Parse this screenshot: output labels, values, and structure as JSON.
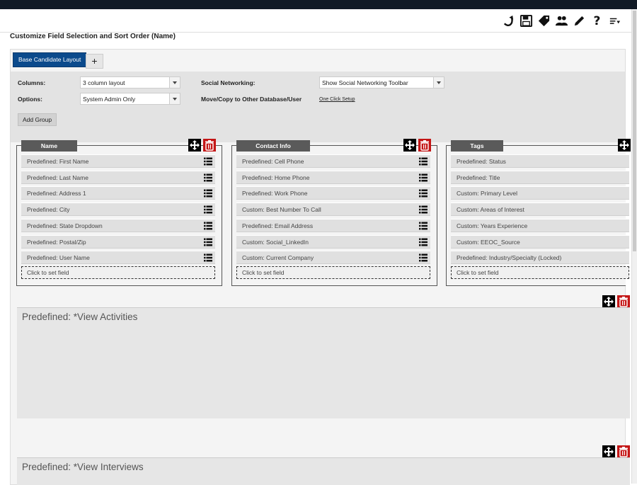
{
  "page_title": "Customize Field Selection and Sort Order (Name)",
  "toolbar": {
    "icons": [
      "return-icon",
      "save-icon",
      "tag-icon",
      "users-icon",
      "edit-icon",
      "help-icon",
      "sort-icon"
    ]
  },
  "tabs": {
    "active_label": "Base Candidate Layout",
    "add_label": "+"
  },
  "settings": {
    "columns_label": "Columns:",
    "columns_value": "3 column layout",
    "options_label": "Options:",
    "options_value": "System Admin Only",
    "social_label": "Social Networking:",
    "social_value": "Show Social Networking Toolbar",
    "move_label": "Move/Copy to Other Database/User",
    "one_click_link": "One Click Setup",
    "add_group_label": "Add Group"
  },
  "groups": [
    {
      "title": "Name",
      "fields": [
        "Predefined: First Name",
        "Predefined: Last Name",
        "Predefined: Address 1",
        "Predefined: City",
        "Predefined: State Dropdown",
        "Predefined: Postal/Zip",
        "Predefined: User Name"
      ],
      "set_field": "Click to set field"
    },
    {
      "title": "Contact Info",
      "fields": [
        "Predefined: Cell Phone",
        "Predefined: Home Phone",
        "Predefined: Work Phone",
        "Custom: Best Number To Call",
        "Predefined: Email Address",
        "Custom: Social_LinkedIn",
        "Custom: Current Company"
      ],
      "set_field": "Click to set field"
    },
    {
      "title": "Tags",
      "fields": [
        "Predefined: Status",
        "Predefined: Title",
        "Custom: Primary Level",
        "Custom: Areas of Interest",
        "Custom: Years Experience",
        "Custom: EEOC_Source",
        "Predefined: Industry/Specialty (Locked)"
      ],
      "set_field": "Click to set field"
    }
  ],
  "panels": [
    "Predefined: *View Activities",
    "Predefined: *View Interviews"
  ],
  "colors": {
    "accent": "#0b4a8c",
    "delete": "#c41616",
    "header": "#5a5a5a"
  }
}
